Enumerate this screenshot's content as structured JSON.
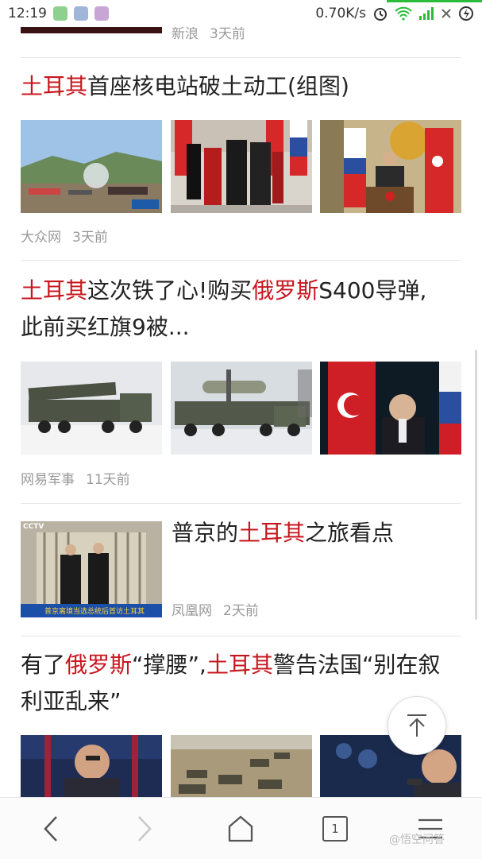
{
  "status_bar": {
    "time": "12:19",
    "net_speed": "0.70K/s"
  },
  "colors": {
    "highlight": "#c8161e",
    "meta": "#999999"
  },
  "feed": {
    "partial_top": {
      "source": "新浪",
      "time": "3天前"
    },
    "articles": [
      {
        "title_parts": [
          {
            "text": "土耳其",
            "highlight": true
          },
          {
            "text": "首座核电站破土动工(组图)",
            "highlight": false
          }
        ],
        "source": "大众网",
        "time": "3天前"
      },
      {
        "title_line1": [
          {
            "text": "土耳其",
            "highlight": true
          },
          {
            "text": "这次铁了心!购买",
            "highlight": false
          },
          {
            "text": "俄罗斯",
            "highlight": true
          },
          {
            "text": "S400导弹,",
            "highlight": false
          }
        ],
        "title_line2": "此前买红旗9被...",
        "source": "网易军事",
        "time": "11天前"
      },
      {
        "title_parts": [
          {
            "text": "普京的",
            "highlight": false
          },
          {
            "text": "土耳其",
            "highlight": true
          },
          {
            "text": "之旅看点",
            "highlight": false
          }
        ],
        "thumb_caption": "普京离境当选总统后首访土耳其",
        "thumb_logo": "CCTV",
        "source": "凤凰网",
        "time": "2天前"
      },
      {
        "title_line1": [
          {
            "text": "有了",
            "highlight": false
          },
          {
            "text": "俄罗斯",
            "highlight": true
          },
          {
            "text": "“撑腰”,",
            "highlight": false
          },
          {
            "text": "土耳其",
            "highlight": true
          },
          {
            "text": "警告法国“别在叙",
            "highlight": false
          }
        ],
        "title_line2": "利亚乱来”"
      }
    ]
  },
  "bottom_nav": {
    "tab_count": "1",
    "watermark": "@悟空问答"
  },
  "icons": [
    "back-icon",
    "forward-icon",
    "home-icon",
    "tabs-icon",
    "menu-icon",
    "scroll-top-icon",
    "alarm-icon",
    "wifi-icon",
    "signal-icon",
    "battery-icon"
  ]
}
